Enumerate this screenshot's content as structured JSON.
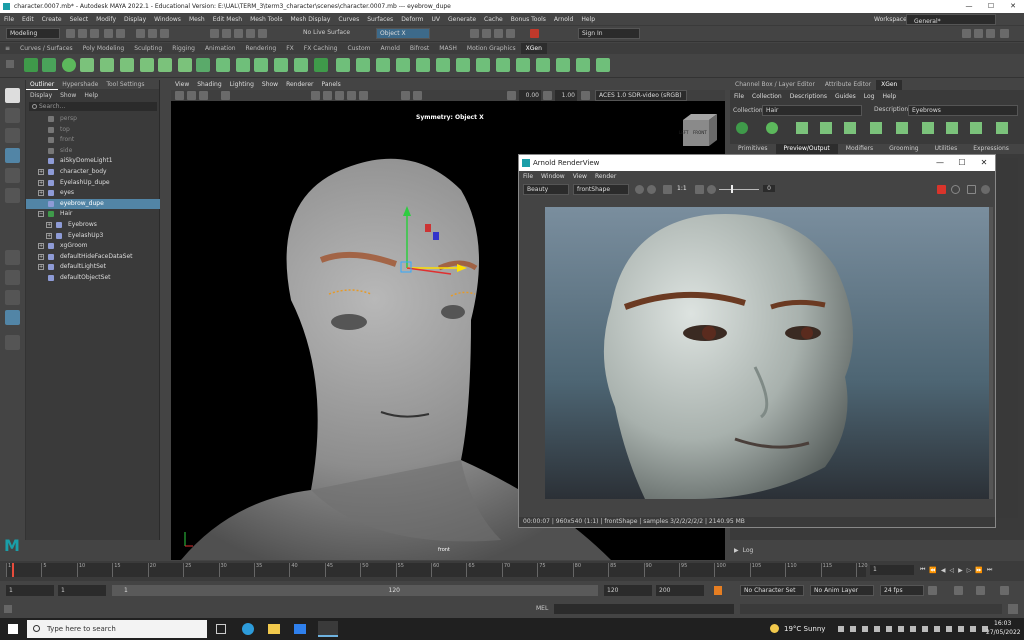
{
  "window": {
    "title": "character.0007.mb* - Autodesk MAYA 2022.1 - Educational Version: E:\\UAL\\TERM_3\\term3_character\\scenes\\character.0007.mb  ---  eyebrow_dupe",
    "controls": [
      "—",
      "☐",
      "✕"
    ]
  },
  "menus": [
    "File",
    "Edit",
    "Create",
    "Select",
    "Modify",
    "Display",
    "Windows",
    "Mesh",
    "Edit Mesh",
    "Mesh Tools",
    "Mesh Display",
    "Curves",
    "Surfaces",
    "Deform",
    "UV",
    "Generate",
    "Cache",
    "Bonus Tools",
    "Arnold",
    "Help"
  ],
  "workspace": {
    "label": "Workspace:",
    "value": "General*"
  },
  "statusline": {
    "mode": "Modeling",
    "live_surface": "No Live Surface",
    "object_field": "Object X",
    "sign_in": "Sign In"
  },
  "shelf_tabs": [
    "Curves / Surfaces",
    "Poly Modeling",
    "Sculpting",
    "Rigging",
    "Animation",
    "Rendering",
    "FX",
    "FX Caching",
    "Custom",
    "Arnold",
    "Bifrost",
    "MASH",
    "Motion Graphics",
    "XGen"
  ],
  "shelf_active": "XGen",
  "outliner": {
    "tabs": [
      "Outliner",
      "Hypershade",
      "Tool Settings"
    ],
    "menu": [
      "Display",
      "Show",
      "Help"
    ],
    "search_placeholder": "Search...",
    "items": [
      {
        "label": "persp",
        "indent": 0,
        "dim": true,
        "expander": ""
      },
      {
        "label": "top",
        "indent": 0,
        "dim": true,
        "expander": ""
      },
      {
        "label": "front",
        "indent": 0,
        "dim": true,
        "expander": ""
      },
      {
        "label": "side",
        "indent": 0,
        "dim": true,
        "expander": ""
      },
      {
        "label": "aiSkyDomeLight1",
        "indent": 0,
        "dim": false,
        "expander": ""
      },
      {
        "label": "character_body",
        "indent": 0,
        "dim": false,
        "expander": "+"
      },
      {
        "label": "EyelashUp_dupe",
        "indent": 0,
        "dim": false,
        "expander": "+"
      },
      {
        "label": "eyes",
        "indent": 0,
        "dim": false,
        "expander": "+"
      },
      {
        "label": "eyebrow_dupe",
        "indent": 0,
        "dim": false,
        "expander": "",
        "selected": true
      },
      {
        "label": "Hair",
        "indent": 0,
        "dim": false,
        "expander": "−"
      },
      {
        "label": "Eyebrows",
        "indent": 1,
        "dim": false,
        "expander": "+"
      },
      {
        "label": "EyelashUp3",
        "indent": 1,
        "dim": false,
        "expander": "+"
      },
      {
        "label": "xgGroom",
        "indent": 0,
        "dim": false,
        "expander": "+"
      },
      {
        "label": "defaultHideFaceDataSet",
        "indent": 0,
        "dim": false,
        "expander": "+"
      },
      {
        "label": "defaultLightSet",
        "indent": 0,
        "dim": false,
        "expander": "+"
      },
      {
        "label": "defaultObjectSet",
        "indent": 0,
        "dim": false,
        "expander": ""
      }
    ]
  },
  "viewport": {
    "menu": [
      "View",
      "Shading",
      "Lighting",
      "Show",
      "Renderer",
      "Panels"
    ],
    "symmetry": "Symmetry: Object X",
    "camera_label": "front",
    "near": "0.00",
    "far": "1.00",
    "colorspace": "ACES 1.0 SDR-video (sRGB)",
    "cube_left": "LEFT",
    "cube_front": "FRONT"
  },
  "channel_box": {
    "tabs": [
      "Channel Box / Layer Editor",
      "Attribute Editor",
      "XGen"
    ],
    "active_tab": "XGen",
    "menu": [
      "File",
      "Collection",
      "Descriptions",
      "Guides",
      "Log",
      "Help"
    ],
    "collection_label": "Collection",
    "collection_value": "Hair",
    "description_label": "Description",
    "description_value": "Eyebrows",
    "subtabs": [
      "Primitives",
      "Preview/Output",
      "Modifiers",
      "Grooming",
      "Utilities",
      "Expressions"
    ],
    "active_subtab": "Preview/Output",
    "log_label": "Log"
  },
  "render_view": {
    "title": "Arnold RenderView",
    "menu": [
      "File",
      "Window",
      "View",
      "Render"
    ],
    "aov": "Beauty",
    "camera": "frontShape",
    "ratio": "1:1",
    "value": "0",
    "status": "00:00:07 | 960x540 (1:1) | frontShape | samples 3/2/2/2/2/2 | 2140.95 MB"
  },
  "timeslider": {
    "ticks": [
      "1",
      "5",
      "10",
      "15",
      "20",
      "25",
      "30",
      "35",
      "40",
      "45",
      "50",
      "55",
      "60",
      "65",
      "70",
      "75",
      "80",
      "85",
      "90",
      "95",
      "100",
      "105",
      "110",
      "115",
      "120"
    ],
    "current_frame": "1"
  },
  "range": {
    "start": "1",
    "start_inner": "1",
    "slider_start": "1",
    "slider_end": "120",
    "end_inner": "120",
    "end": "200",
    "character_set": "No Character Set",
    "anim_layer": "No Anim Layer",
    "fps": "24 fps"
  },
  "cmdline": {
    "label": "MEL"
  },
  "taskbar": {
    "search_placeholder": "Type here to search",
    "weather": "19°C  Sunny",
    "time": "16:03",
    "date": "27/05/2022"
  },
  "colors": {
    "accent": "#5285a6",
    "maya_bg": "#444444",
    "viewport_bg": "#000000"
  }
}
